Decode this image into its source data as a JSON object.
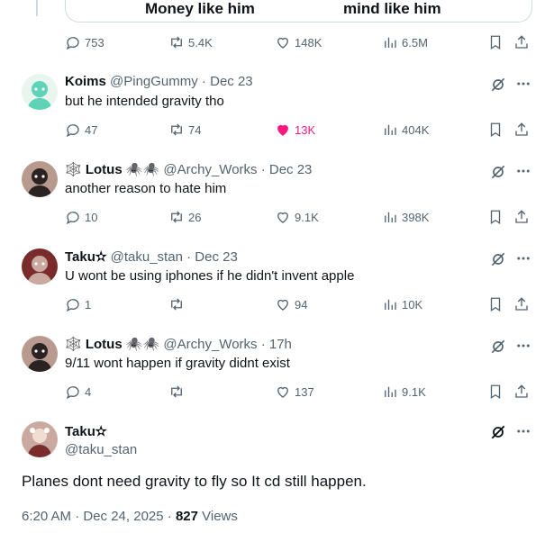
{
  "meme": {
    "left_text": "Money like him",
    "right_text": "mind like him"
  },
  "top_actions": {
    "replies": "753",
    "reposts": "5.4K",
    "likes": "148K",
    "views": "6.5M"
  },
  "replies": [
    {
      "name": "Koims",
      "handle": "@PingGummy",
      "sep": " · ",
      "time": "Dec 23",
      "text": "but he intended gravity tho",
      "replies": "47",
      "reposts": "74",
      "likes": "13K",
      "views": "404K",
      "liked": true,
      "avatar_colors": [
        "#5fd3b8",
        "#e9f5ef"
      ]
    },
    {
      "name": "Lotus",
      "badge": "🕸️",
      "name_emoji": "🕷️🕷️",
      "handle": "@Archy_Works",
      "sep": " · ",
      "time": "Dec 23",
      "text": "another reason to hate him",
      "replies": "10",
      "reposts": "26",
      "likes": "9.1K",
      "views": "398K",
      "liked": false,
      "avatar_colors": [
        "#2b2222",
        "#b89a8e"
      ]
    },
    {
      "name": "Taku✫",
      "handle": "@taku_stan",
      "sep": " · ",
      "time": "Dec 23",
      "text": "U wont be using iphones if he didn't invent apple",
      "replies": "1",
      "reposts": "",
      "likes": "94",
      "views": "10K",
      "liked": false,
      "avatar_colors": [
        "#c9a9a0",
        "#7a2b2b"
      ]
    },
    {
      "name": "Lotus",
      "badge": "🕸️",
      "name_emoji": "🕷️🕷️",
      "handle": "@Archy_Works",
      "sep": " · ",
      "time": "17h",
      "text": "9/11 wont happen if gravity didnt exist",
      "replies": "4",
      "reposts": "",
      "likes": "137",
      "views": "9.1K",
      "liked": false,
      "avatar_colors": [
        "#2b2222",
        "#b89a8e"
      ]
    }
  ],
  "main_tweet": {
    "name": "Taku✫",
    "handle": "@taku_stan",
    "text": "Planes dont need gravity to fly so It cd still happen.",
    "time": "6:20 AM · Dec 24, 2025 · ",
    "views_count": "827",
    "views_label": " Views"
  }
}
